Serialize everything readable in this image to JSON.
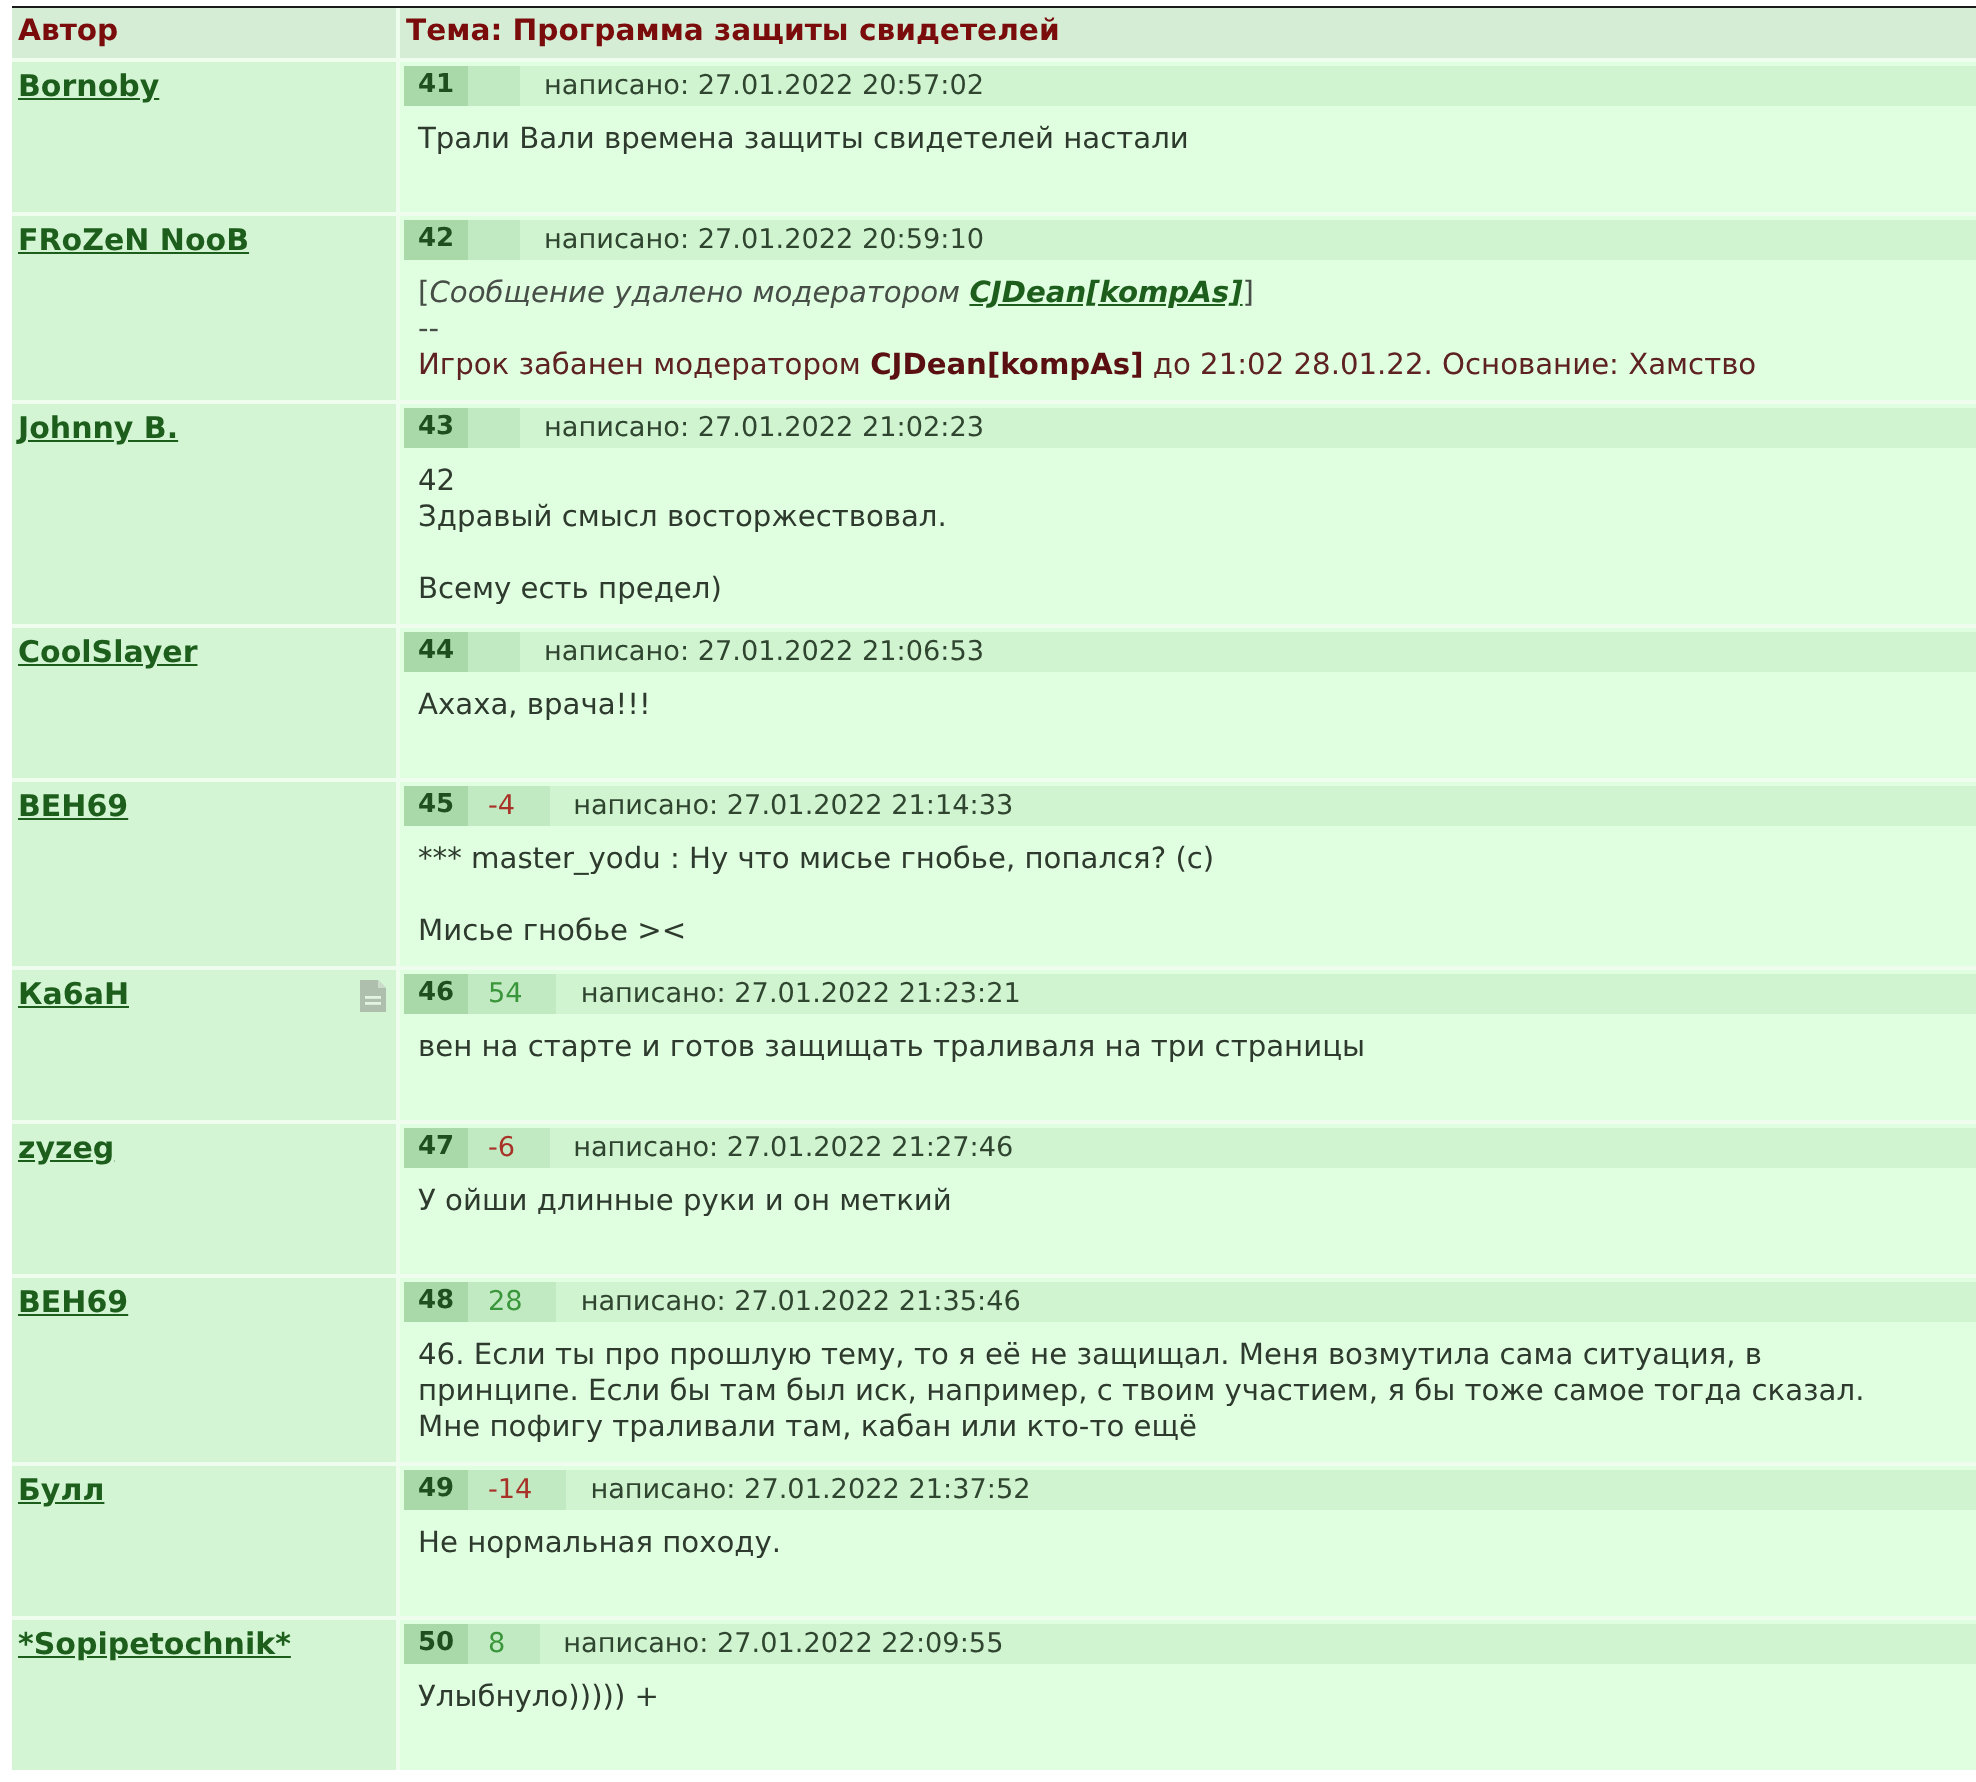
{
  "table": {
    "columns": [
      "Автор",
      "Тема: Программа защиты свидетелей"
    ]
  },
  "posts": [
    {
      "author": "Bornoby",
      "has_note": false,
      "number": "41",
      "posted": "написано: 27.01.2022 20:57:02",
      "paragraphs": [
        "Трали Вали времена защиты свидетелей настали"
      ]
    },
    {
      "author": "FRoZeN NooB",
      "has_note": false,
      "number": "42",
      "posted": "написано: 27.01.2022 20:59:10",
      "moderation": {
        "before": "[*Сообщение удалено модератором* ",
        "moderator": "CJDean[kompAs]",
        "after": "]",
        "separator": "--",
        "ban": "Игрок забанен модератором **CJDean[kompAs]** до 21:02 28.01.22. Основание: Хамство"
      }
    },
    {
      "author": "Johnny B.",
      "has_note": false,
      "number": "43",
      "posted": "написано: 27.01.2022 21:02:23",
      "paragraphs": [
        "42\nЗдравый смысл восторжествовал.",
        "Всему есть предел)"
      ]
    },
    {
      "author": "CoolSlayer",
      "has_note": false,
      "number": "44",
      "posted": "написано: 27.01.2022 21:06:53",
      "paragraphs": [
        "Ахаха, врача!!!"
      ]
    },
    {
      "author": "BEH69",
      "has_note": false,
      "number": "45",
      "rating": {
        "text": "-4",
        "color": "#a83228"
      },
      "posted": "написано: 27.01.2022 21:14:33",
      "paragraphs": [
        "*** master_yodu : Ну что мисье гнобье, попался? (с)",
        "Мисье гнобье ><"
      ]
    },
    {
      "author": "Ка6аН",
      "has_note": true,
      "number": "46",
      "rating": {
        "text": "54",
        "color": "#3a963a"
      },
      "posted": "написано: 27.01.2022 21:23:21",
      "paragraphs": [
        "вен на старте и готов защищать траливаля на три страницы"
      ]
    },
    {
      "author": "zyzeg",
      "has_note": false,
      "number": "47",
      "rating": {
        "text": "-6",
        "color": "#a83228"
      },
      "posted": "написано: 27.01.2022 21:27:46",
      "paragraphs": [
        "У ойши длинные руки и он меткий"
      ]
    },
    {
      "author": "BEH69",
      "has_note": false,
      "number": "48",
      "rating": {
        "text": "28",
        "color": "#3a963a"
      },
      "posted": "написано: 27.01.2022 21:35:46",
      "paragraphs": [
        "46. Если ты про прошлую тему, то я её не защищал. Меня возмутила сама ситуация, в принципе. Если бы там был иск, например, с твоим участием, я бы тоже самое тогда сказал. Мне пофигу траливали там, кабан или кто-то ещё"
      ]
    },
    {
      "author": "Булл",
      "has_note": false,
      "number": "49",
      "rating": {
        "text": "-14",
        "color": "#a83228"
      },
      "posted": "написано: 27.01.2022 21:37:52",
      "paragraphs": [
        "Не нормальная походу."
      ]
    },
    {
      "author": "*Sopipetochnik*",
      "has_note": false,
      "number": "50",
      "rating": {
        "text": "8",
        "color": "#3a963a"
      },
      "posted": "написано: 27.01.2022 22:09:55",
      "paragraphs": [
        "Улыбнуло))))) +"
      ]
    }
  ]
}
